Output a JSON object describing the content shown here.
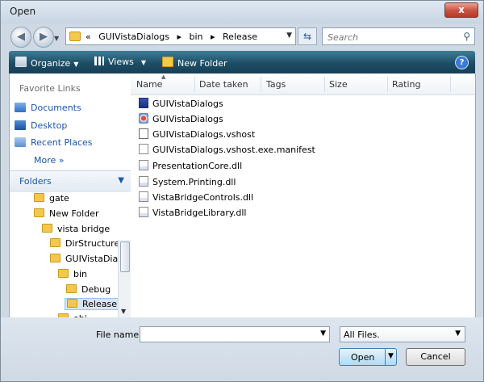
{
  "window": {
    "title": "Open",
    "close_label": "x"
  },
  "nav": {
    "back_icon": "back-arrow-icon",
    "forward_icon": "forward-arrow-icon"
  },
  "address": {
    "prefix": "«",
    "crumbs": [
      "GUIVistaDialogs",
      "bin",
      "Release"
    ],
    "separator": "▸"
  },
  "search": {
    "placeholder": "Search"
  },
  "toolbar": {
    "organize": "Organize",
    "views": "Views",
    "new_folder": "New Folder",
    "help": "?"
  },
  "favorites": {
    "heading": "Favorite Links",
    "items": [
      "Documents",
      "Desktop",
      "Recent Places"
    ],
    "more": "More",
    "more_glyph": "»"
  },
  "folders": {
    "heading": "Folders",
    "tree": [
      {
        "label": "gate",
        "depth": 1
      },
      {
        "label": "New Folder",
        "depth": 1
      },
      {
        "label": "vista bridge",
        "depth": 2
      },
      {
        "label": "DirStructure",
        "depth": 3
      },
      {
        "label": "GUIVistaDialo",
        "depth": 3
      },
      {
        "label": "bin",
        "depth": 4
      },
      {
        "label": "Debug",
        "depth": 5
      },
      {
        "label": "Release",
        "depth": 5,
        "selected": true
      },
      {
        "label": "obj",
        "depth": 4
      }
    ]
  },
  "columns": [
    "Name",
    "Date taken",
    "Tags",
    "Size",
    "Rating"
  ],
  "files": [
    {
      "name": "GUIVistaDialogs",
      "icon": "exe-icon"
    },
    {
      "name": "GUIVistaDialogs",
      "icon": "app-icon"
    },
    {
      "name": "GUIVistaDialogs.vshost",
      "icon": "vshost-icon"
    },
    {
      "name": "GUIVistaDialogs.vshost.exe.manifest",
      "icon": "file-icon"
    },
    {
      "name": "PresentationCore.dll",
      "icon": "dll-icon"
    },
    {
      "name": "System.Printing.dll",
      "icon": "dll-icon"
    },
    {
      "name": "VistaBridgeControls.dll",
      "icon": "dll-icon"
    },
    {
      "name": "VistaBridgeLibrary.dll",
      "icon": "dll-icon"
    }
  ],
  "bottom": {
    "filename_label": "File name:",
    "filename_value": "",
    "filter_value": "All Files.",
    "open_label": "Open",
    "cancel_label": "Cancel"
  },
  "colors": {
    "toolbar": "#1d4e66",
    "link": "#1a56a8",
    "selection": "#d6e6f8"
  }
}
